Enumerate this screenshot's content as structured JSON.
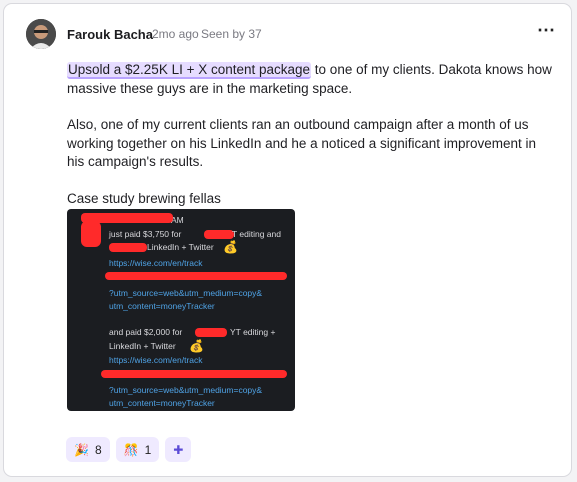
{
  "post": {
    "author": "Farouk Bacha",
    "time": "2mo ago",
    "seen": "Seen by 37",
    "more_icon": "⋯",
    "highlight": "Upsold a $2.25K LI + X content package",
    "line1_rest": " to one of my clients. Dakota knows how massive these guys are in the marketing space.",
    "para2": "Also, one of my current clients ran an outbound campaign after a month of us working together on his LinkedIn and he a noticed a significant improvement in his campaign's results.",
    "para3": "Case study brewing fellas"
  },
  "screenshot": {
    "am": "AM",
    "msg1_a": "just paid $3,750 for",
    "msg1_b": "T editing and",
    "msg1_c": "LinkedIn + Twitter",
    "money_emoji": "💰",
    "link1": "https://wise.com/en/track",
    "params1_a": "?utm_source=web&utm_medium=copy&",
    "params1_b": "utm_content=moneyTracker",
    "msg2_a": "and paid $2,000 for",
    "msg2_b": "YT editing +",
    "msg2_c": "LinkedIn + Twitter",
    "link2": "https://wise.com/en/track",
    "params2_a": "?utm_source=web&utm_medium=copy&",
    "params2_b": "utm_content=moneyTracker"
  },
  "reactions": [
    {
      "icon": "party-popper-icon",
      "glyph": "🎉",
      "count": "8"
    },
    {
      "icon": "confetti-icon",
      "glyph": "🎊",
      "count": "1"
    },
    {
      "icon": "add-reaction-icon",
      "glyph": "✚"
    }
  ],
  "colors": {
    "highlight": "#e6dcff",
    "redaction": "#ff2a2a",
    "link": "#4fa3e6",
    "reaction_bg": "#efeaff"
  }
}
